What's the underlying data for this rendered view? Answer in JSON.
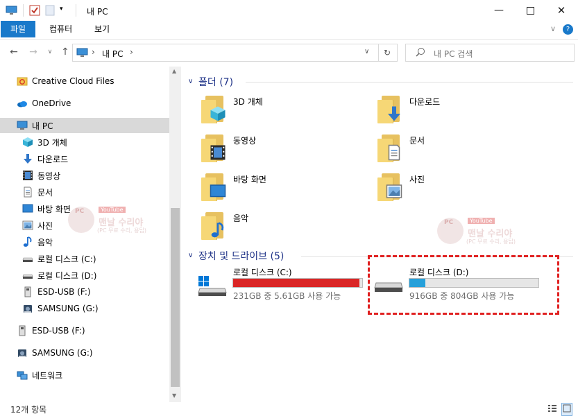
{
  "window": {
    "title": "내 PC"
  },
  "ribbon": {
    "tabs": [
      "파일",
      "컴퓨터",
      "보기"
    ]
  },
  "address": {
    "crumbs": [
      "내 PC"
    ]
  },
  "search": {
    "placeholder": "내 PC 검색"
  },
  "sidebar": {
    "items": [
      {
        "label": "Creative Cloud Files",
        "icon": "creative-cloud-icon"
      },
      {
        "label": "OneDrive",
        "icon": "onedrive-cloud-icon"
      },
      {
        "label": "내 PC",
        "icon": "pc-monitor-icon",
        "selected": true
      },
      {
        "label": "3D 개체",
        "icon": "cube-3d-icon"
      },
      {
        "label": "다운로드",
        "icon": "download-arrow-icon"
      },
      {
        "label": "동영상",
        "icon": "film-icon"
      },
      {
        "label": "문서",
        "icon": "document-icon"
      },
      {
        "label": "바탕 화면",
        "icon": "desktop-icon"
      },
      {
        "label": "사진",
        "icon": "picture-icon"
      },
      {
        "label": "음악",
        "icon": "music-note-icon"
      },
      {
        "label": "로컬 디스크 (C:)",
        "icon": "drive-icon"
      },
      {
        "label": "로컬 디스크 (D:)",
        "icon": "drive-icon"
      },
      {
        "label": "ESD-USB (F:)",
        "icon": "usb-drive-icon"
      },
      {
        "label": "SAMSUNG (G:)",
        "icon": "external-drive-icon"
      },
      {
        "label": "ESD-USB (F:)",
        "icon": "usb-drive-icon"
      },
      {
        "label": "SAMSUNG (G:)",
        "icon": "external-drive-icon"
      },
      {
        "label": "네트워크",
        "icon": "network-icon"
      }
    ]
  },
  "folders": {
    "header": "폴더 (7)",
    "items": [
      {
        "label": "3D 개체",
        "icon": "cube-3d-icon"
      },
      {
        "label": "다운로드",
        "icon": "download-arrow-icon"
      },
      {
        "label": "동영상",
        "icon": "film-icon"
      },
      {
        "label": "문서",
        "icon": "document-icon"
      },
      {
        "label": "바탕 화면",
        "icon": "desktop-icon"
      },
      {
        "label": "사진",
        "icon": "picture-icon"
      },
      {
        "label": "음악",
        "icon": "music-note-icon"
      }
    ]
  },
  "drives": {
    "header": "장치 및 드라이브 (5)",
    "items": [
      {
        "label": "로컬 디스크 (C:)",
        "info": "231GB 중 5.61GB 사용 가능",
        "used_fraction": 0.976,
        "bar_color": "#da2626"
      },
      {
        "label": "로컬 디스크 (D:)",
        "info": "916GB 중 804GB 사용 가능",
        "used_fraction": 0.122,
        "bar_color": "#26a0da"
      }
    ]
  },
  "watermark": {
    "line1": "맨날 수리야",
    "line2": "(PC 무료 수리, 용팁)",
    "badge": "YouTube",
    "pc": "PC"
  },
  "status": {
    "count": "12개 항목"
  },
  "colors": {
    "accent": "#1979ca",
    "highlight_box": "#e02020",
    "selected_bg": "#cce8ff"
  }
}
